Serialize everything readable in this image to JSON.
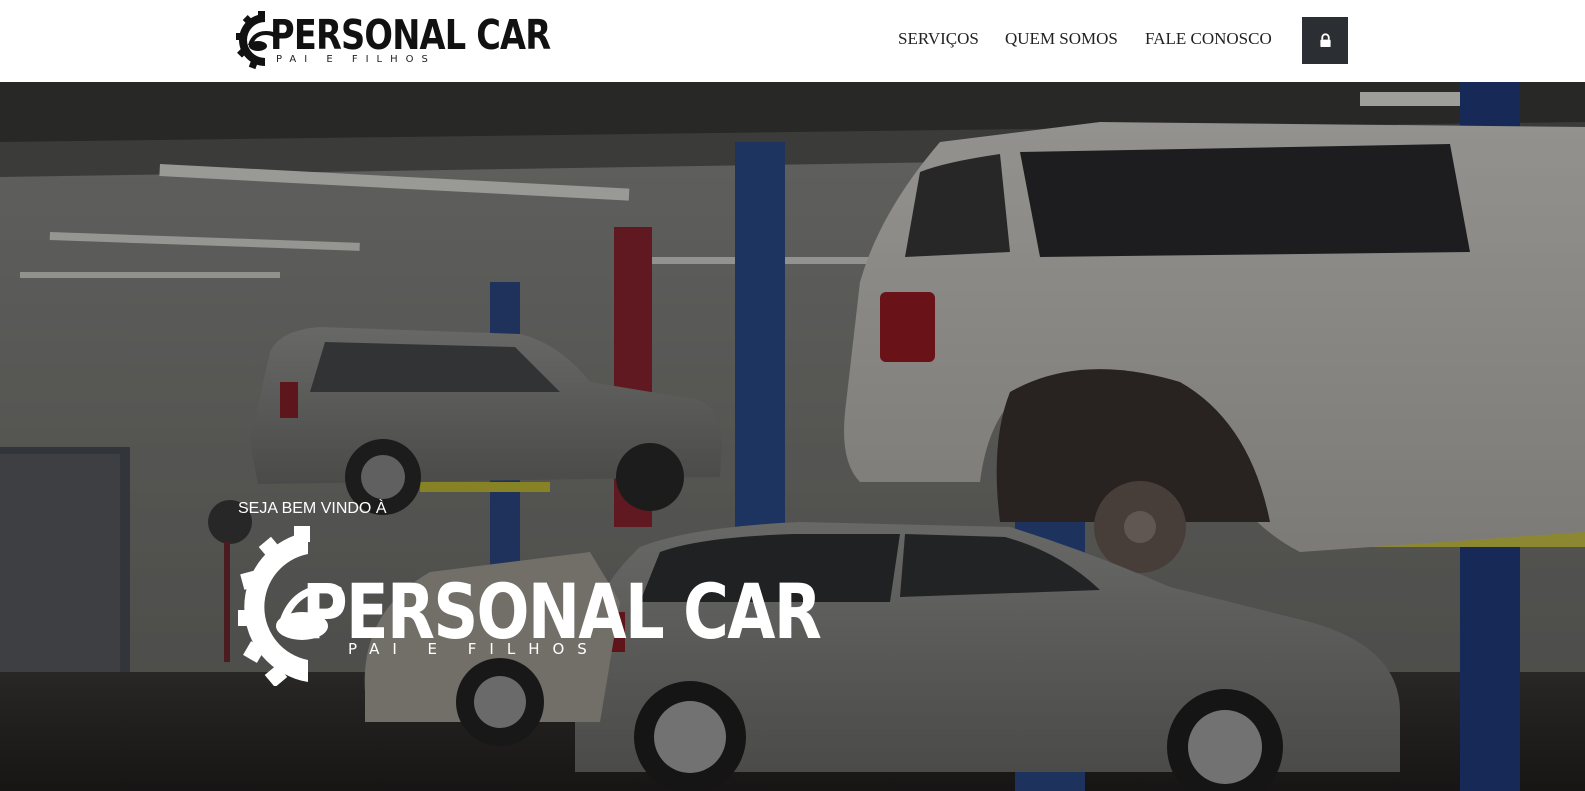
{
  "header": {
    "logo": {
      "wordmark": "PERSONAL CAR",
      "tagline": "PAI E FILHOS",
      "icon": "gear-car-icon"
    },
    "nav": [
      {
        "label": "SERVIÇOS"
      },
      {
        "label": "QUEM SOMOS"
      },
      {
        "label": "FALE CONOSCO"
      }
    ],
    "lock_button": {
      "icon": "lock-icon"
    }
  },
  "hero": {
    "background": "auto-repair-garage-photo",
    "welcome": "SEJA BEM VINDO À",
    "logo": {
      "wordmark": "PERSONAL CAR",
      "tagline": "PAI E FILHOS",
      "icon": "gear-car-icon"
    }
  },
  "colors": {
    "header_bg": "#ffffff",
    "nav_text": "#222222",
    "lock_button_bg": "#2b2f33",
    "hero_text": "#ffffff"
  }
}
